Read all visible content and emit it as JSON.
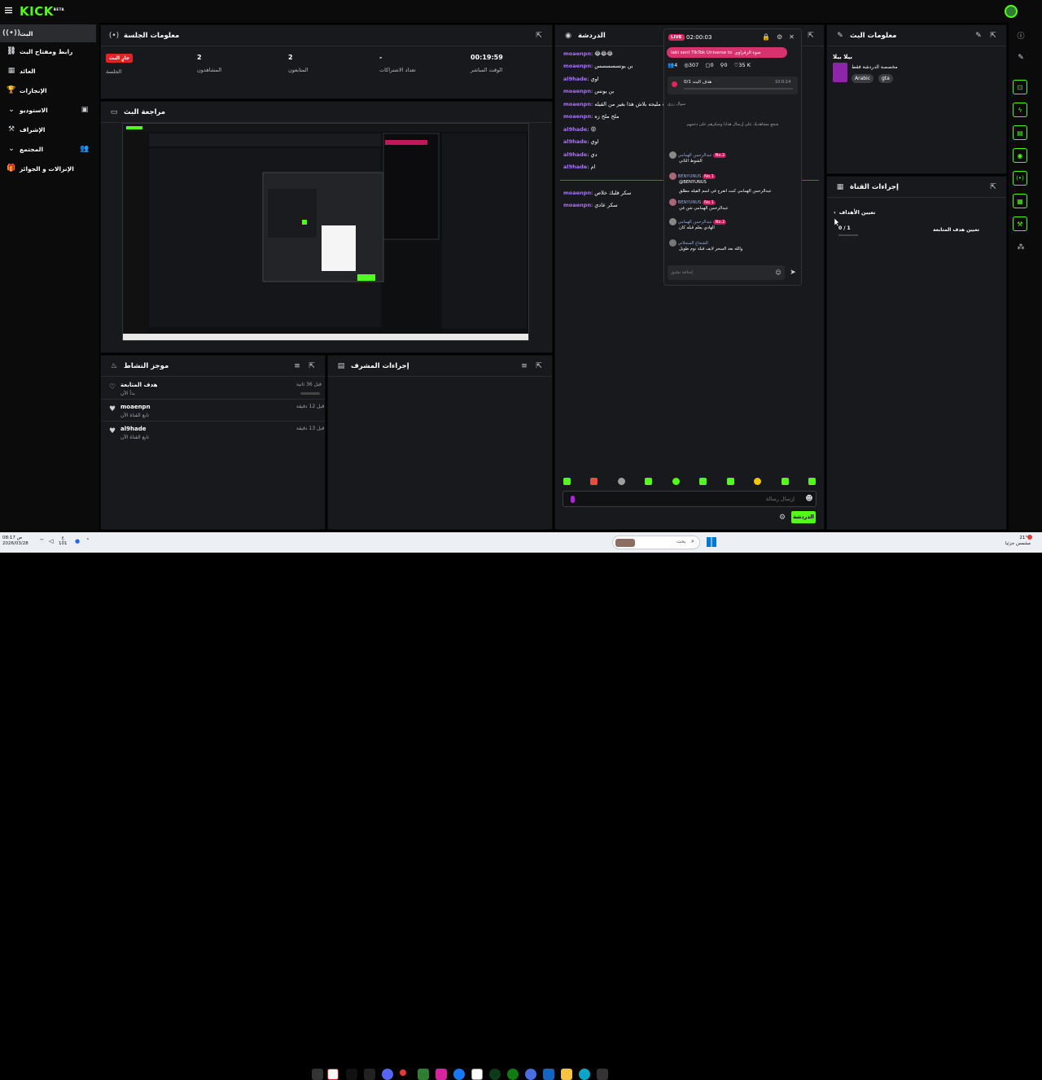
{
  "app": {
    "logo": "KICK",
    "logo_badge": "BETA"
  },
  "sidebar": {
    "items": [
      {
        "label": "البث",
        "icon": "broadcast-icon"
      },
      {
        "label": "رابط ومفتاح البث",
        "icon": "link-icon"
      },
      {
        "label": "العائد",
        "icon": "revenue-icon"
      },
      {
        "label": "الإنجازات",
        "icon": "trophy-icon"
      },
      {
        "label": "الاستوديو",
        "icon": "studio-icon"
      },
      {
        "label": "الإشراف",
        "icon": "moderation-icon"
      },
      {
        "label": "المجتمع",
        "icon": "community-icon"
      },
      {
        "label": "الإنزالات و الجوائز",
        "icon": "drops-icon"
      }
    ]
  },
  "session": {
    "title": "معلومات الجلسة",
    "live_badge": "جارٍ البث",
    "stats": [
      {
        "value": "",
        "label": "الجلسة"
      },
      {
        "value": "2",
        "label": "المشاهدون"
      },
      {
        "value": "2",
        "label": "المتابعون"
      },
      {
        "value": "-",
        "label": "تعداد الاشتراكات"
      },
      {
        "value": "00:19:59",
        "label": "الوقت المباشر"
      }
    ]
  },
  "preview": {
    "title": "مراجعة البث"
  },
  "activity": {
    "title": "موجز النشاط",
    "items": [
      {
        "name": "هدف المتابعة",
        "sub": "بدأ الآن",
        "time": "قبل 36 ثانية",
        "progress": 0.0
      },
      {
        "name": "moaenpn",
        "sub": "تابع القناة الآن",
        "time": "قبل 12 دقيقة"
      },
      {
        "name": "al9hade",
        "sub": "تابع القناة الآن",
        "time": "قبل 13 دقيقة"
      }
    ]
  },
  "modactions": {
    "title": "إجراءات المشرف"
  },
  "chat": {
    "title": "الدردشة",
    "messages": [
      {
        "user": "moaenpn",
        "text": "😂😂😂"
      },
      {
        "user": "moaenpn",
        "text": "بن يونسسسسس"
      },
      {
        "user": "al9hade",
        "text": "اوي"
      },
      {
        "user": "moaenpn",
        "text": "بن يونس"
      },
      {
        "user": "moaenpn",
        "text": "الله او جوده مليحه بلاش هذا بغير من القيله"
      },
      {
        "user": "moaenpn",
        "text": "ملح ملح زه"
      },
      {
        "user": "al9hade",
        "text": "😡"
      },
      {
        "user": "al9hade",
        "text": "اوي"
      },
      {
        "user": "al9hade",
        "text": "دي"
      },
      {
        "user": "al9hade",
        "text": "ام"
      },
      {
        "user": "moaenpn",
        "text": "سكر قلبك خلاص"
      },
      {
        "user": "moaenpn",
        "text": "سكر عادي"
      }
    ],
    "input_placeholder": "إرسال رسالة",
    "send_label": "الدردشة"
  },
  "overlay": {
    "live": "LIVE",
    "time": "02:00:03",
    "gift_text": "labi sent TikTok Universe to",
    "gift_target": "ضوء الرفراوي",
    "stats": [
      "4",
      "307",
      "0",
      "0",
      "35 K"
    ],
    "goal_label": "هدف البث",
    "goal_value": "0/1",
    "goal_time": "10:0:14",
    "hint1": "سوال زري",
    "hint2": "شجع مشاهديك على إرسال هدايا وشكرهم على دعمهم",
    "comments": [
      {
        "user": "عبدالرحمن الهمامي",
        "badge": "No.2",
        "text": "الشوط الثاني"
      },
      {
        "user": "BENYUNUS",
        "badge": "No.1",
        "text": "@BENYUNUS"
      },
      {
        "user": "BENYUNUS",
        "badge": "No.1",
        "text": "عبدالرحمن الهمامي كنت أتفرج في اسم القيله مطلق"
      },
      {
        "user": "عبدالرحمن الهمامي",
        "badge": "No.1",
        "text": "عبدالرحمن الهمامي شن في"
      },
      {
        "user": "عبدالرحمن الهمامي",
        "badge": "No.2",
        "text": "الهادي يعلم قبله كان"
      },
      {
        "user": "الشجاع السجلاني",
        "badge": "",
        "text": "والله بعد السحر لايف قبلة نوم طويل"
      }
    ],
    "input_placeholder": "إضافة تعليق"
  },
  "streaminfo": {
    "title": "معلومات البث",
    "stream_title": "بيلا بيلا",
    "category": "مخصصة الدردشة فقط",
    "tags": [
      "Arabic",
      "gta"
    ]
  },
  "channelactions": {
    "title": "إجراءات القناة",
    "back_label": "تعيين الأهداف",
    "goal_label": "تعيين هدف المتابعة",
    "goal_value": "0 / 1"
  },
  "taskbar": {
    "time": "08:17 ص",
    "date": "2026/03/28",
    "temp": "21°C",
    "weather": "مشمس جزئيا",
    "search_placeholder": "بحث",
    "lang": "ع",
    "badge": "101"
  }
}
